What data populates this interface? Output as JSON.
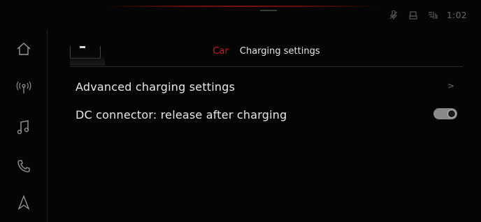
{
  "status_bar": {
    "icons": [
      "mute-mic-icon",
      "seat-icon",
      "wireless-charging-icon"
    ],
    "time": "1:02"
  },
  "sidebar": {
    "items": [
      {
        "name": "home-icon"
      },
      {
        "name": "radio-icon"
      },
      {
        "name": "music-icon"
      },
      {
        "name": "phone-icon"
      },
      {
        "name": "navigation-icon"
      }
    ]
  },
  "header": {
    "section": "Car",
    "title": "Charging settings"
  },
  "list": {
    "items": [
      {
        "label": "Advanced charging settings",
        "control": "chevron",
        "chevron": ">"
      },
      {
        "label": "DC connector: release after charging",
        "control": "toggle",
        "on": true
      }
    ]
  },
  "colors": {
    "accent": "#c81e1e",
    "background": "#050505",
    "text": "#e6e6e6"
  }
}
